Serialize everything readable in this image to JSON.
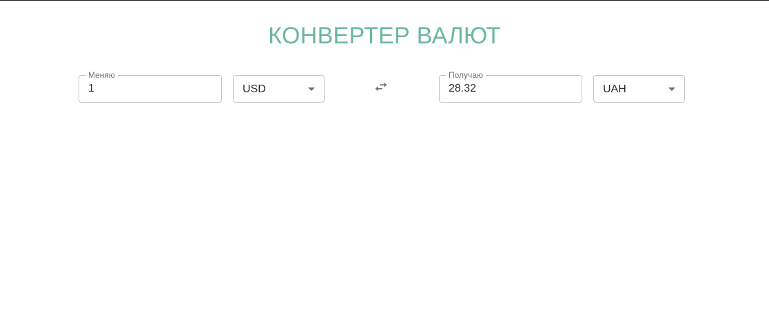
{
  "header": {
    "title": "КОНВЕРТЕР ВАЛЮТ"
  },
  "from": {
    "label": "Меняю",
    "amount": "1",
    "currency": "USD"
  },
  "to": {
    "label": "Получаю",
    "amount": "28.32",
    "currency": "UAH"
  },
  "icons": {
    "swap": "swap-horiz-icon",
    "dropdown": "arrow-drop-down-icon"
  },
  "colors": {
    "title": "#6ab7a2",
    "border": "#c4c4c4",
    "icon": "#6e6e6e"
  }
}
